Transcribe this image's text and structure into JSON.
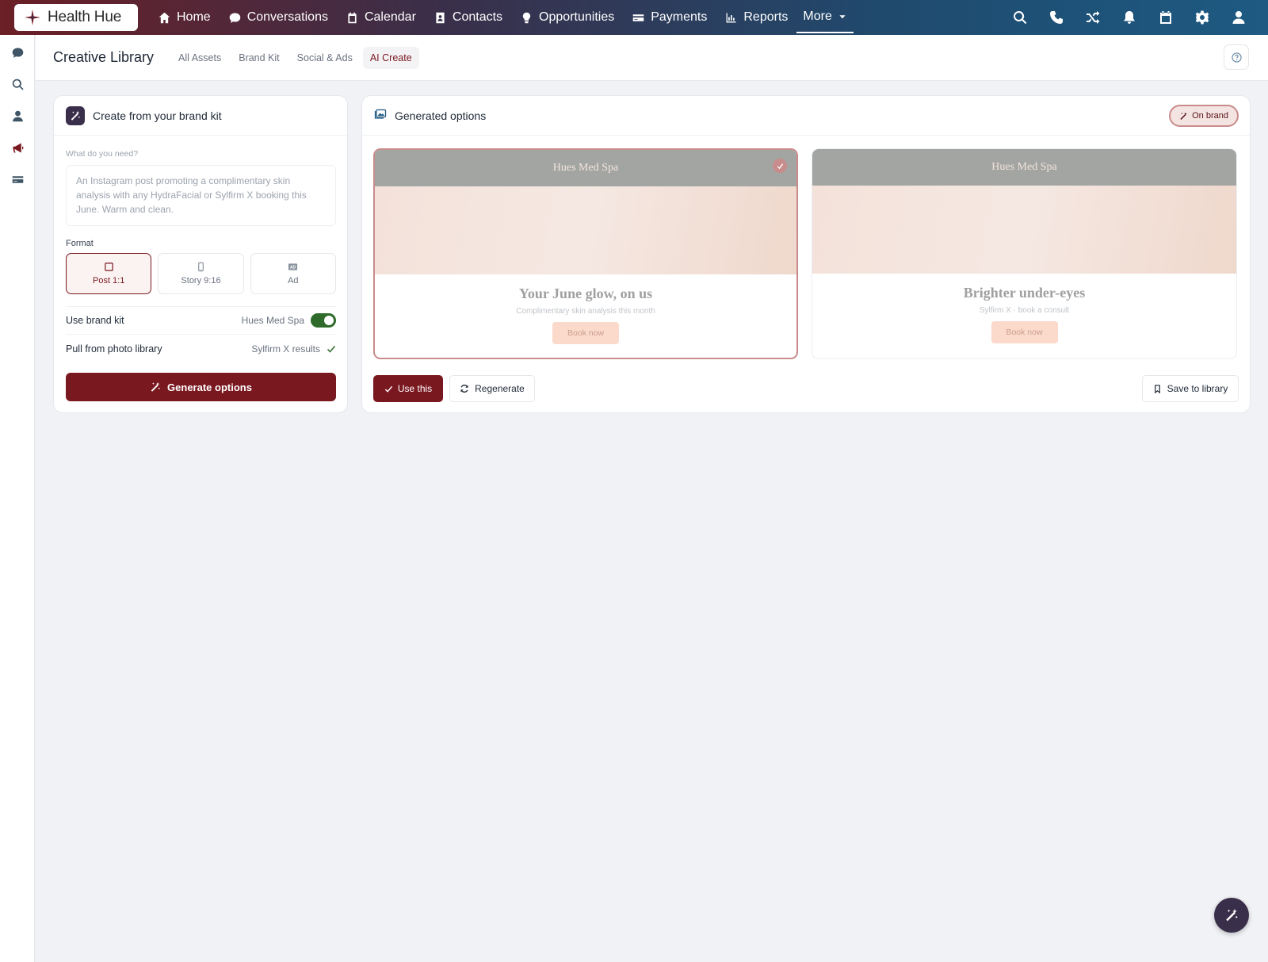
{
  "app": {
    "logo_text": "Health Hue"
  },
  "nav": {
    "items": [
      {
        "label": "Home",
        "icon": "home-icon"
      },
      {
        "label": "Conversations",
        "icon": "chat-icon"
      },
      {
        "label": "Calendar",
        "icon": "calendar-icon"
      },
      {
        "label": "Contacts",
        "icon": "contacts-icon"
      },
      {
        "label": "Opportunities",
        "icon": "lightbulb-icon"
      },
      {
        "label": "Payments",
        "icon": "card-icon"
      },
      {
        "label": "Reports",
        "icon": "bar-chart-icon"
      }
    ],
    "more_label": "More",
    "actions": [
      "search-icon",
      "phone-icon",
      "shuffle-icon",
      "bell-icon",
      "calendar-icon",
      "gear-icon",
      "user-icon"
    ]
  },
  "rail": {
    "icons": [
      "chat-icon",
      "search-icon",
      "user-icon",
      "megaphone-icon",
      "card-icon"
    ],
    "active": "megaphone-icon"
  },
  "page": {
    "title": "Creative Library",
    "tabs": [
      {
        "label": "All Assets"
      },
      {
        "label": "Brand Kit"
      },
      {
        "label": "Social & Ads"
      },
      {
        "label": "AI Create"
      }
    ],
    "active_tab": "AI Create"
  },
  "create": {
    "title": "Create from your brand kit",
    "prompt_label": "What do you need?",
    "prompt_placeholder": "An Instagram post promoting a complimentary skin analysis with any HydraFacial or Sylfirm X booking this June. Warm and clean.",
    "format_label": "Format",
    "formats": [
      {
        "label": "Post 1:1",
        "icon": "square-icon"
      },
      {
        "label": "Story 9:16",
        "icon": "phone-portrait-icon"
      },
      {
        "label": "Ad",
        "icon": "ad-icon"
      }
    ],
    "selected_format": "Post 1:1",
    "brand_kit_label": "Use brand kit",
    "brand_kit_value": "Hues Med Spa",
    "brand_kit_enabled": true,
    "photo_label": "Pull from photo library",
    "photo_value": "Sylfirm X results",
    "generate_label": "Generate options"
  },
  "generated": {
    "title": "Generated options",
    "badge": "On brand",
    "options": [
      {
        "brand": "Hues Med Spa",
        "headline": "Your June glow, on us",
        "sub": "Complimentary skin analysis this month",
        "cta": "Book now",
        "selected": true
      },
      {
        "brand": "Hues Med Spa",
        "headline": "Brighter under-eyes",
        "sub": "Sylfirm X · book a consult",
        "cta": "Book now",
        "selected": false
      }
    ],
    "use_label": "Use this",
    "regen_label": "Regenerate",
    "save_label": "Save to library"
  },
  "colors": {
    "primary": "#7a1820",
    "accent_dark": "#3a2f4a",
    "toggle_on": "#2e6b2a"
  }
}
